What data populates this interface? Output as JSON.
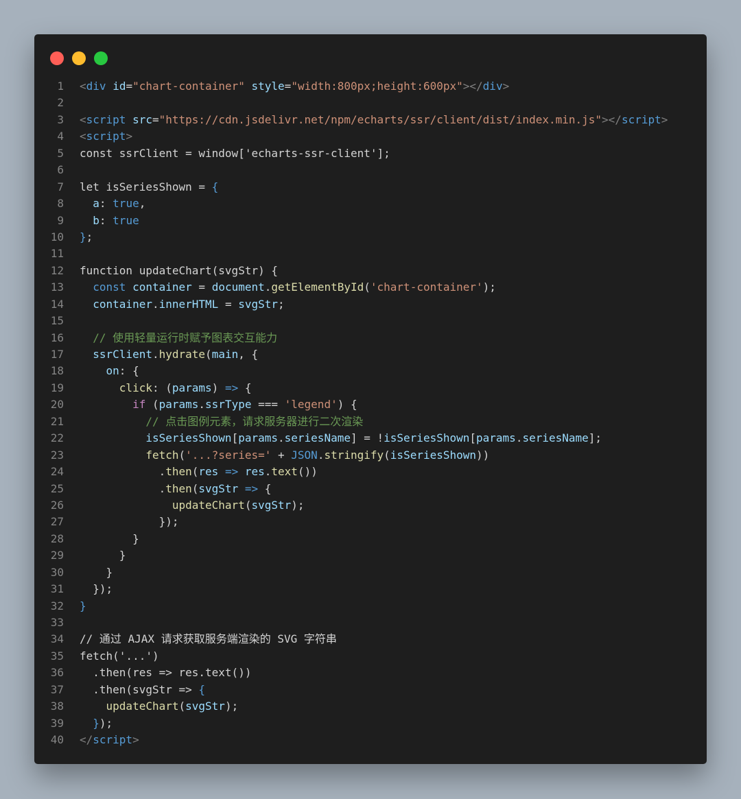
{
  "window_controls": [
    "close",
    "minimize",
    "maximize"
  ],
  "colors": {
    "background": "#a6b1bc",
    "editor_bg": "#1e1e1e",
    "close": "#ff5f57",
    "minimize": "#febc2e",
    "maximize": "#28c840"
  },
  "code": {
    "lines": [
      [
        [
          "t",
          "<"
        ],
        [
          "tg",
          "div"
        ],
        [
          "o",
          " "
        ],
        [
          "a",
          "id"
        ],
        [
          "o",
          "="
        ],
        [
          "s",
          "\"chart-container\""
        ],
        [
          "o",
          " "
        ],
        [
          "a",
          "style"
        ],
        [
          "o",
          "="
        ],
        [
          "s",
          "\"width:800px;height:600px\""
        ],
        [
          "t",
          "></"
        ],
        [
          "tg",
          "div"
        ],
        [
          "t",
          ">"
        ]
      ],
      [],
      [
        [
          "t",
          "<"
        ],
        [
          "tg",
          "script"
        ],
        [
          "o",
          " "
        ],
        [
          "a",
          "src"
        ],
        [
          "o",
          "="
        ],
        [
          "s",
          "\"https://cdn.jsdelivr.net/npm/echarts/ssr/client/dist/index.min.js\""
        ],
        [
          "t",
          "></"
        ],
        [
          "tg",
          "script"
        ],
        [
          "t",
          ">"
        ]
      ],
      [
        [
          "t",
          "<"
        ],
        [
          "tg",
          "script"
        ],
        [
          "t",
          ">"
        ]
      ],
      [
        [
          "o",
          "const ssrClient = window['echarts-ssr-client'];"
        ]
      ],
      [],
      [
        [
          "o",
          "let isSeriesShown = "
        ],
        [
          "b",
          "{"
        ]
      ],
      [
        [
          "o",
          "  "
        ],
        [
          "a",
          "a"
        ],
        [
          "o",
          ": "
        ],
        [
          "b",
          "true"
        ],
        [
          "o",
          ","
        ]
      ],
      [
        [
          "o",
          "  "
        ],
        [
          "a",
          "b"
        ],
        [
          "o",
          ": "
        ],
        [
          "b",
          "true"
        ]
      ],
      [
        [
          "b",
          "}"
        ],
        [
          "o",
          ";"
        ]
      ],
      [],
      [
        [
          "o",
          "function updateChart(svgStr) {"
        ]
      ],
      [
        [
          "o",
          "  "
        ],
        [
          "b",
          "const"
        ],
        [
          "o",
          " "
        ],
        [
          "v",
          "container"
        ],
        [
          "o",
          " = "
        ],
        [
          "v",
          "document"
        ],
        [
          "o",
          "."
        ],
        [
          "f",
          "getElementById"
        ],
        [
          "o",
          "("
        ],
        [
          "s",
          "'chart-container'"
        ],
        [
          "o",
          ");"
        ]
      ],
      [
        [
          "o",
          "  "
        ],
        [
          "v",
          "container"
        ],
        [
          "o",
          "."
        ],
        [
          "a",
          "innerHTML"
        ],
        [
          "o",
          " = "
        ],
        [
          "v",
          "svgStr"
        ],
        [
          "o",
          ";"
        ]
      ],
      [],
      [
        [
          "o",
          "  "
        ],
        [
          "c",
          "// 使用轻量运行时赋予图表交互能力"
        ]
      ],
      [
        [
          "o",
          "  "
        ],
        [
          "v",
          "ssrClient"
        ],
        [
          "o",
          "."
        ],
        [
          "f",
          "hydrate"
        ],
        [
          "o",
          "("
        ],
        [
          "v",
          "main"
        ],
        [
          "o",
          ", {"
        ]
      ],
      [
        [
          "o",
          "    "
        ],
        [
          "a",
          "on"
        ],
        [
          "o",
          ": {"
        ]
      ],
      [
        [
          "o",
          "      "
        ],
        [
          "f",
          "click"
        ],
        [
          "o",
          ": ("
        ],
        [
          "v",
          "params"
        ],
        [
          "o",
          ") "
        ],
        [
          "b",
          "=>"
        ],
        [
          "o",
          " {"
        ]
      ],
      [
        [
          "o",
          "        "
        ],
        [
          "k",
          "if"
        ],
        [
          "o",
          " ("
        ],
        [
          "v",
          "params"
        ],
        [
          "o",
          "."
        ],
        [
          "a",
          "ssrType"
        ],
        [
          "o",
          " === "
        ],
        [
          "s",
          "'legend'"
        ],
        [
          "o",
          ") {"
        ]
      ],
      [
        [
          "o",
          "          "
        ],
        [
          "c",
          "// 点击图例元素，请求服务器进行二次渲染"
        ]
      ],
      [
        [
          "o",
          "          "
        ],
        [
          "v",
          "isSeriesShown"
        ],
        [
          "o",
          "["
        ],
        [
          "v",
          "params"
        ],
        [
          "o",
          "."
        ],
        [
          "a",
          "seriesName"
        ],
        [
          "o",
          "] = !"
        ],
        [
          "v",
          "isSeriesShown"
        ],
        [
          "o",
          "["
        ],
        [
          "v",
          "params"
        ],
        [
          "o",
          "."
        ],
        [
          "a",
          "seriesName"
        ],
        [
          "o",
          "];"
        ]
      ],
      [
        [
          "o",
          "          "
        ],
        [
          "f",
          "fetch"
        ],
        [
          "o",
          "("
        ],
        [
          "s",
          "'...?series='"
        ],
        [
          "o",
          " + "
        ],
        [
          "b",
          "JSON"
        ],
        [
          "o",
          "."
        ],
        [
          "f",
          "stringify"
        ],
        [
          "o",
          "("
        ],
        [
          "v",
          "isSeriesShown"
        ],
        [
          "o",
          "))"
        ]
      ],
      [
        [
          "o",
          "            ."
        ],
        [
          "f",
          "then"
        ],
        [
          "o",
          "("
        ],
        [
          "v",
          "res"
        ],
        [
          "o",
          " "
        ],
        [
          "b",
          "=>"
        ],
        [
          "o",
          " "
        ],
        [
          "v",
          "res"
        ],
        [
          "o",
          "."
        ],
        [
          "f",
          "text"
        ],
        [
          "o",
          "())"
        ]
      ],
      [
        [
          "o",
          "            ."
        ],
        [
          "f",
          "then"
        ],
        [
          "o",
          "("
        ],
        [
          "v",
          "svgStr"
        ],
        [
          "o",
          " "
        ],
        [
          "b",
          "=>"
        ],
        [
          "o",
          " {"
        ]
      ],
      [
        [
          "o",
          "              "
        ],
        [
          "f",
          "updateChart"
        ],
        [
          "o",
          "("
        ],
        [
          "v",
          "svgStr"
        ],
        [
          "o",
          ");"
        ]
      ],
      [
        [
          "o",
          "            });"
        ]
      ],
      [
        [
          "o",
          "        }"
        ]
      ],
      [
        [
          "o",
          "      }"
        ]
      ],
      [
        [
          "o",
          "    }"
        ]
      ],
      [
        [
          "o",
          "  });"
        ]
      ],
      [
        [
          "b",
          "}"
        ]
      ],
      [],
      [
        [
          "o",
          "// 通过 AJAX 请求获取服务端渲染的 SVG 字符串"
        ]
      ],
      [
        [
          "o",
          "fetch('...')"
        ]
      ],
      [
        [
          "o",
          "  .then(res => res.text())"
        ]
      ],
      [
        [
          "o",
          "  .then(svgStr => "
        ],
        [
          "b",
          "{"
        ]
      ],
      [
        [
          "o",
          "    "
        ],
        [
          "f",
          "updateChart"
        ],
        [
          "o",
          "("
        ],
        [
          "v",
          "svgStr"
        ],
        [
          "o",
          ");"
        ]
      ],
      [
        [
          "o",
          "  "
        ],
        [
          "b",
          "}"
        ],
        [
          "o",
          ");"
        ]
      ],
      [
        [
          "t",
          "</"
        ],
        [
          "tg",
          "script"
        ],
        [
          "t",
          ">"
        ]
      ]
    ]
  }
}
